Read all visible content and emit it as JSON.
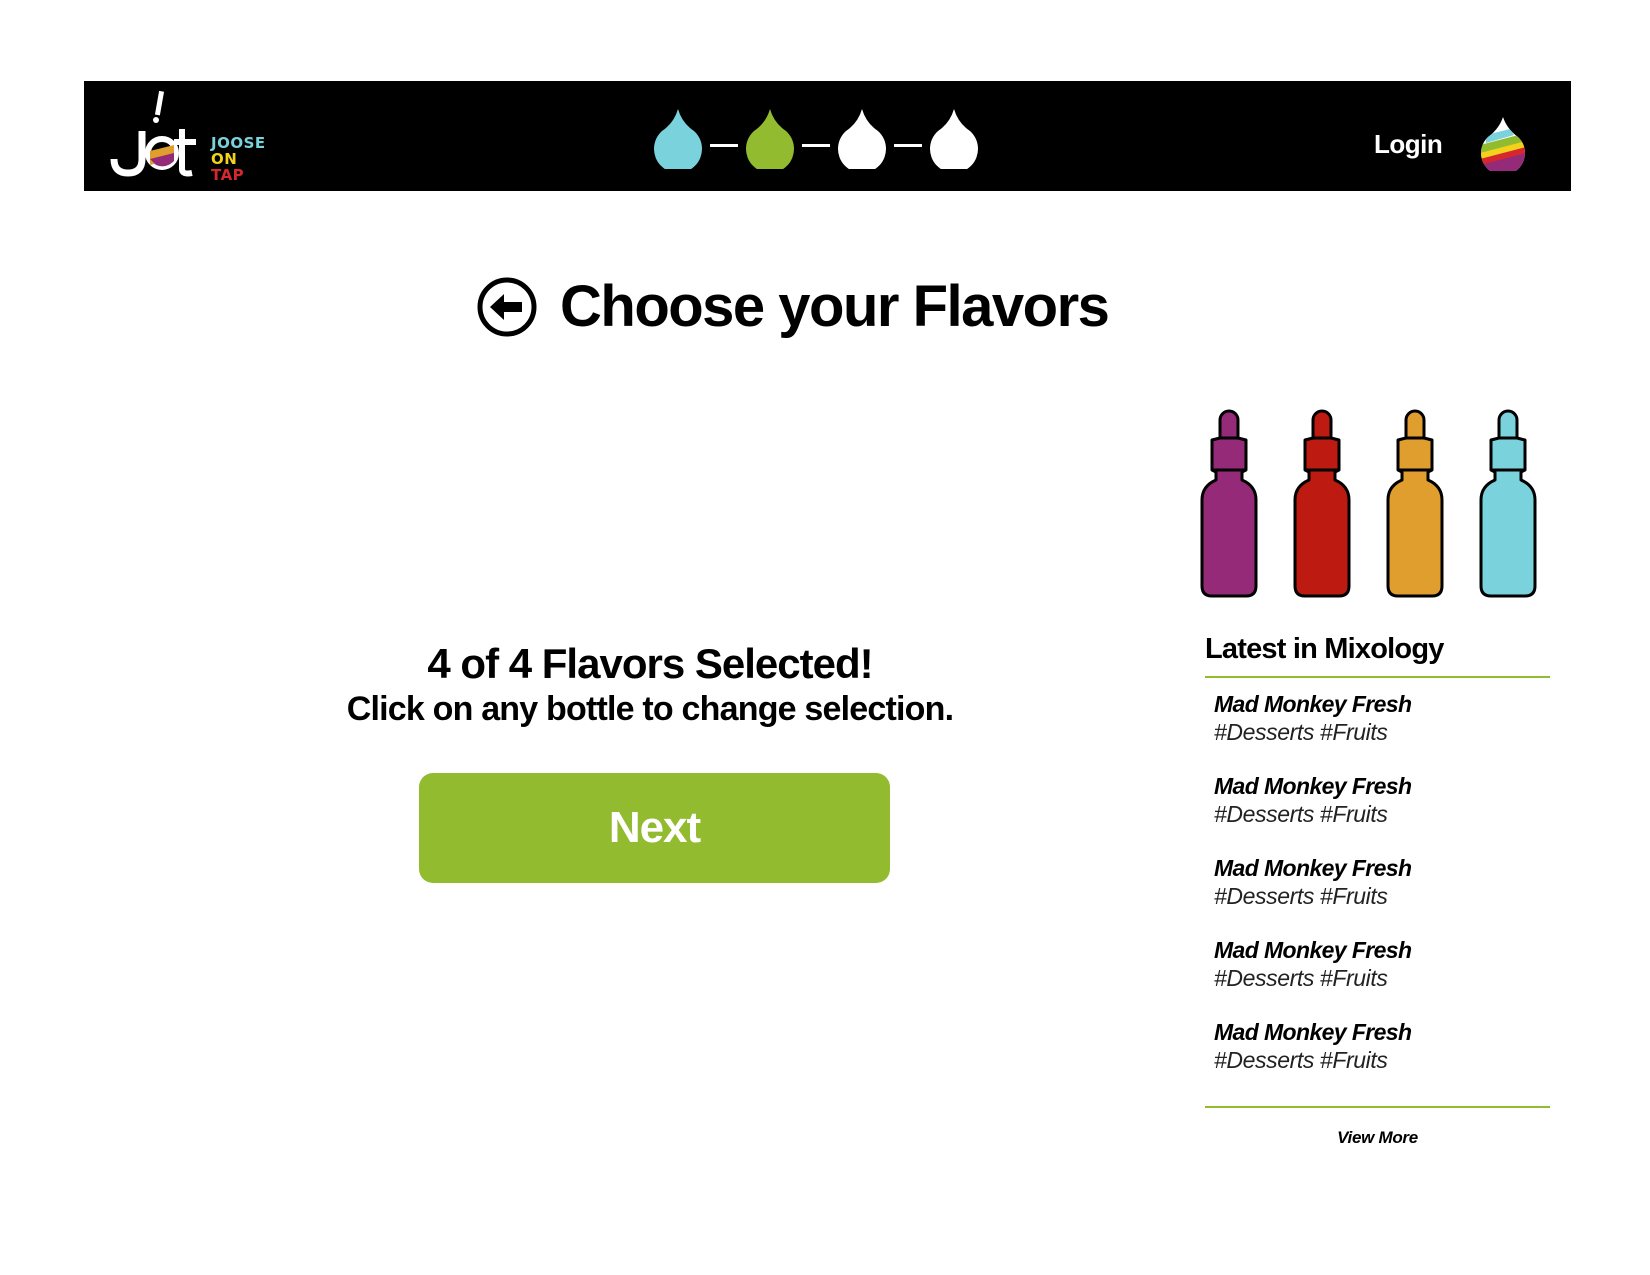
{
  "header": {
    "logo": {
      "text_lines": [
        "JOOSE",
        "ON",
        "TAP"
      ],
      "mark": "JoT"
    },
    "steps": [
      {
        "name": "step-1",
        "color": "#79d2dc",
        "state": "done"
      },
      {
        "name": "step-2",
        "color": "#92bb30",
        "state": "current"
      },
      {
        "name": "step-3",
        "color": "#ffffff",
        "state": "todo"
      },
      {
        "name": "step-4",
        "color": "#ffffff",
        "state": "todo"
      }
    ],
    "login_label": "Login",
    "user_icon": "rainbow-drop-icon"
  },
  "page": {
    "title": "Choose your Flavors",
    "back_icon": "back-arrow-icon"
  },
  "selection": {
    "count_text": "4 of 4 Flavors Selected!",
    "hint_text": "Click on any bottle to change selection.",
    "next_label": "Next"
  },
  "bottles": [
    {
      "color": "#942a78"
    },
    {
      "color": "#bd1a12"
    },
    {
      "color": "#e09e2e"
    },
    {
      "color": "#79d2dc"
    }
  ],
  "sidebar": {
    "title": "Latest in Mixology",
    "items": [
      {
        "name": "Mad Monkey Fresh",
        "tags": "#Desserts #Fruits"
      },
      {
        "name": "Mad Monkey Fresh",
        "tags": "#Desserts #Fruits"
      },
      {
        "name": "Mad Monkey Fresh",
        "tags": "#Desserts #Fruits"
      },
      {
        "name": "Mad Monkey Fresh",
        "tags": "#Desserts #Fruits"
      },
      {
        "name": "Mad Monkey Fresh",
        "tags": "#Desserts #Fruits"
      }
    ],
    "view_more_label": "View More"
  },
  "colors": {
    "accent_green": "#92bb30",
    "header_bg": "#000000",
    "logo_cyan": "#79d2dc",
    "logo_yellow": "#f2d21b",
    "logo_red": "#d6262e"
  }
}
